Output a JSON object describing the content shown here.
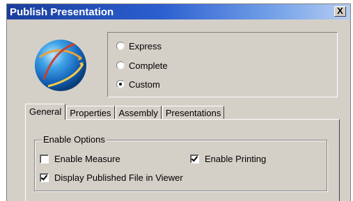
{
  "window": {
    "title": "Publish Presentation",
    "close_label": "X"
  },
  "icons": {
    "app": "globe-icon",
    "close": "close-icon"
  },
  "publish_mode": {
    "options": [
      {
        "label": "Express",
        "selected": false
      },
      {
        "label": "Complete",
        "selected": false
      },
      {
        "label": "Custom",
        "selected": true
      }
    ]
  },
  "tabs": [
    {
      "label": "General",
      "active": true
    },
    {
      "label": "Properties",
      "active": false
    },
    {
      "label": "Assembly",
      "active": false
    },
    {
      "label": "Presentations",
      "active": false
    }
  ],
  "general": {
    "group_label": "Enable Options",
    "enable_measure": {
      "label": "Enable Measure",
      "checked": false
    },
    "enable_printing": {
      "label": "Enable Printing",
      "checked": true
    },
    "display_viewer": {
      "label": "Display Published File in Viewer",
      "checked": true
    }
  },
  "colors": {
    "face": "#d4d0c8",
    "title_start": "#1a3e9c",
    "title_end": "#b6cdf2"
  }
}
